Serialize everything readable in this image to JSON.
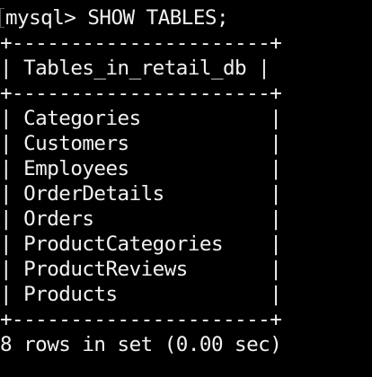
{
  "terminal": {
    "prompt": "mysql> ",
    "command": "SHOW TABLES;",
    "border": "+----------------------+",
    "header_row": "| Tables_in_retail_db |",
    "rows": [
      "| Categories           |",
      "| Customers            |",
      "| Employees            |",
      "| OrderDetails         |",
      "| Orders               |",
      "| ProductCategories    |",
      "| ProductReviews       |",
      "| Products             |"
    ],
    "footer": "8 rows in set (0.00 sec)",
    "colors": {
      "background": "#000000",
      "text": "#f2f2f2"
    }
  }
}
